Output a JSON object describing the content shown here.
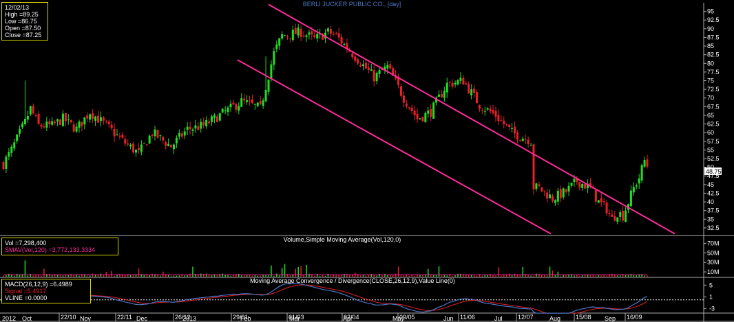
{
  "chart_data": [
    {
      "type": "candlestick",
      "title": "BERLI JUCKER PUBLIC CO., [day]",
      "y_ticks": [
        "95",
        "92.5",
        "90",
        "87.5",
        "85",
        "82.5",
        "80",
        "77.5",
        "75",
        "72.5",
        "70",
        "67.5",
        "65",
        "62.5",
        "60",
        "57.5",
        "55",
        "52.5",
        "50",
        "47.5",
        "45",
        "42.5",
        "40",
        "37.5",
        "35",
        "32.5"
      ],
      "ylim": [
        30.5,
        97.5
      ],
      "last_price": "48.75",
      "info": {
        "date": "12/02/13",
        "high": "High =89.25",
        "low": "Low =86.75",
        "open": "Open =87.50",
        "close": "Close =87.25"
      },
      "trendlines": [
        {
          "from": [
            "29/01",
            81
          ],
          "to": [
            "Aug",
            30.8
          ]
        },
        {
          "from": [
            "Jan",
            97
          ],
          "to": [
            "Sep",
            30.8
          ]
        }
      ],
      "colors": {
        "up": "#22dd22",
        "down": "#e8202a",
        "trendline": "#ff2b9c",
        "axis_text": "#ffffff",
        "title": "#4d79c4"
      },
      "grid": false
    },
    {
      "type": "bar",
      "title": "Volume,Simple Moving Average(Vol,120,0)",
      "y_ticks": [
        "70M",
        "50M",
        "30M",
        "10M"
      ],
      "info": {
        "vol": "Vol =7,298,400",
        "sma": "SMAV(Vol,120) =3,772,133.3334"
      },
      "colors": {
        "up": "#22dd22",
        "down": "#e8202a",
        "sma": "#ff2b9c"
      }
    },
    {
      "type": "line",
      "title": "Moving Average Convergence / Divergence(CLOSE,26,12,9),Value Line(0)",
      "y_ticks": [
        "5",
        "1",
        "-3"
      ],
      "info": {
        "macd": "MACD(26,12,9) =6.4989",
        "signal": "Signal =5.4917",
        "vline": "VLINE =0.0000"
      },
      "colors": {
        "macd": "#4d79c4",
        "signal": "#e8202a",
        "vline": "#ffffff"
      }
    }
  ],
  "x_axis": {
    "top_labels": [
      "22/10",
      "22/11",
      "26/12",
      "29/01",
      "01/03",
      "02/04",
      "09/05",
      "11/06",
      "12/07",
      "15/08",
      "16/09"
    ],
    "bottom_labels": [
      "2012",
      "Oct",
      "Nov",
      "Dec",
      "2013",
      "Feb",
      "Mar",
      "Apr",
      "May",
      "Jun",
      "Jul",
      "Aug",
      "Sep"
    ]
  }
}
